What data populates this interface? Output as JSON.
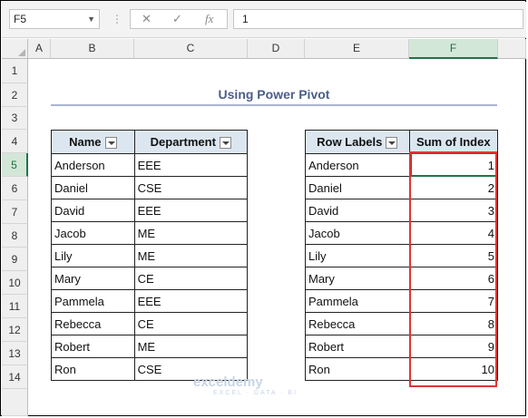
{
  "formula_bar": {
    "name_box": "F5",
    "formula": "1",
    "cancel_glyph": "✕",
    "enter_glyph": "✓",
    "fx_glyph": "fx"
  },
  "columns": [
    "A",
    "B",
    "C",
    "D",
    "E",
    "F"
  ],
  "rows": [
    "1",
    "2",
    "3",
    "4",
    "5",
    "6",
    "7",
    "8",
    "9",
    "10",
    "11",
    "12",
    "13",
    "14"
  ],
  "sheet": {
    "title": "Using Power Pivot",
    "source_table": {
      "headers": [
        "Name",
        "Department"
      ],
      "rows": [
        [
          "Anderson",
          "EEE"
        ],
        [
          "Daniel",
          "CSE"
        ],
        [
          "David",
          "EEE"
        ],
        [
          "Jacob",
          "ME"
        ],
        [
          "Lily",
          "ME"
        ],
        [
          "Mary",
          "CE"
        ],
        [
          "Pammela",
          "EEE"
        ],
        [
          "Rebecca",
          "CE"
        ],
        [
          "Robert",
          "ME"
        ],
        [
          "Ron",
          "CSE"
        ]
      ]
    },
    "pivot_table": {
      "headers": [
        "Row Labels",
        "Sum of Index"
      ],
      "rows": [
        [
          "Anderson",
          "1"
        ],
        [
          "Daniel",
          "2"
        ],
        [
          "David",
          "3"
        ],
        [
          "Jacob",
          "4"
        ],
        [
          "Lily",
          "5"
        ],
        [
          "Mary",
          "6"
        ],
        [
          "Pammela",
          "7"
        ],
        [
          "Rebecca",
          "8"
        ],
        [
          "Robert",
          "9"
        ],
        [
          "Ron",
          "10"
        ]
      ]
    }
  },
  "watermark": {
    "brand": "exceldemy",
    "tagline": "EXCEL · DATA · BI"
  },
  "colors": {
    "highlight": "#e03434",
    "selection": "#217346",
    "header_fill": "#dce6f0"
  }
}
